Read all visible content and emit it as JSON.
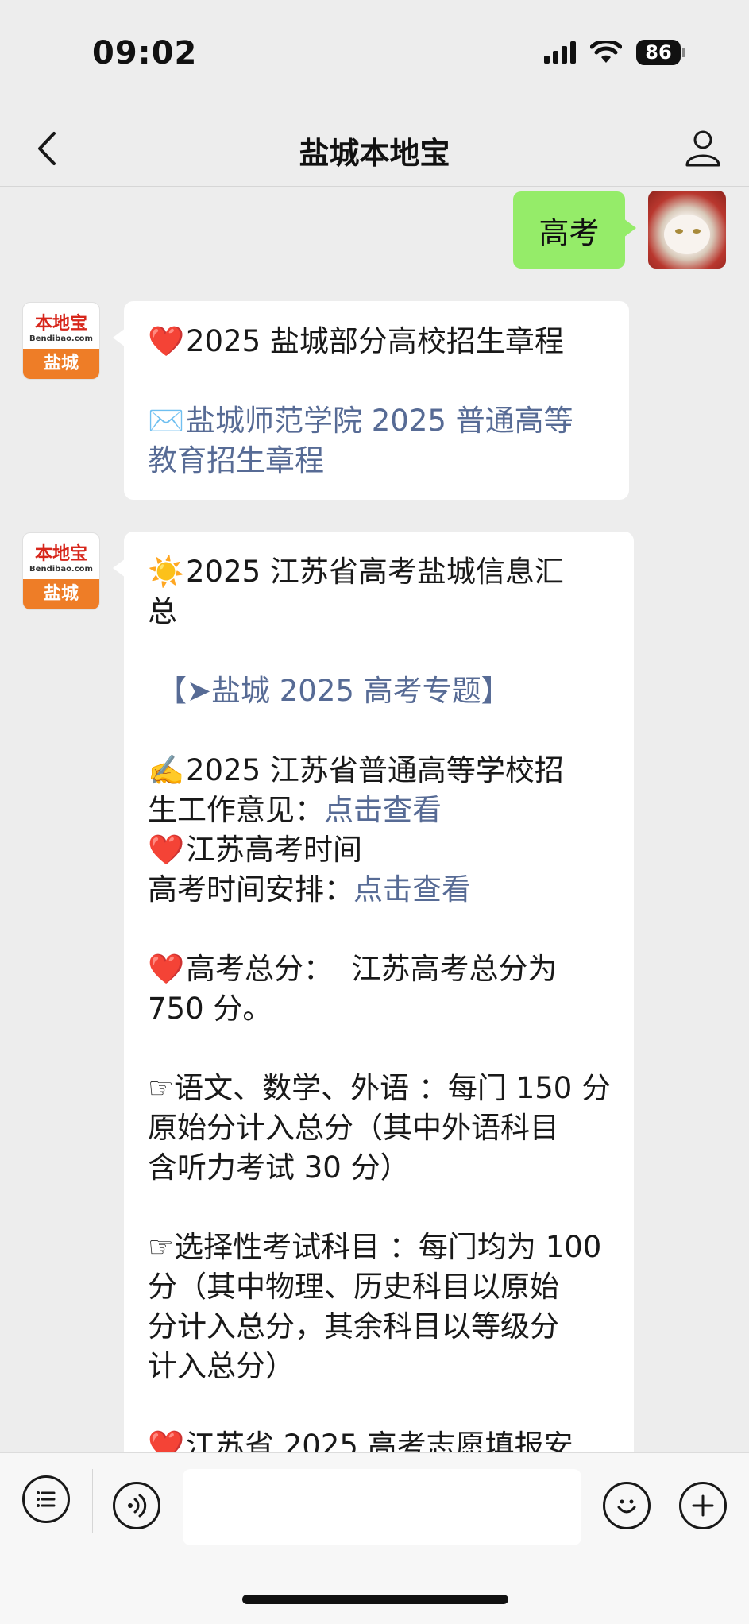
{
  "status_bar": {
    "time": "09:02",
    "battery": "86"
  },
  "nav": {
    "title": "盐城本地宝"
  },
  "user_message": {
    "text": "高考"
  },
  "bot": {
    "avatar_brand": "本地宝",
    "avatar_domain": "Bendibao.com",
    "avatar_city": "盐城"
  },
  "message1": {
    "line1_emoji": "❤️",
    "line1": "2025 盐城部分高校招生章程",
    "link_emoji": "✉️",
    "link_text_line1": "盐城师范学院 2025 普通高等",
    "link_text_line2": "教育招生章程"
  },
  "message2": {
    "title_emoji": "☀️",
    "title_line1": "2025 江苏省高考盐城信息汇",
    "title_line2": "总",
    "topic_link": "【➤盐城 2025 高考专题】",
    "item1_emoji": "✍️",
    "item1_line1": "2025 江苏省普通高等学校招",
    "item1_line2_prefix": "生工作意见：",
    "item1_link": "点击查看",
    "item2_emoji": "❤️",
    "item2_title": "江苏高考时间",
    "item2_prefix": "高考时间安排：",
    "item2_link": "点击查看",
    "item3_emoji": "❤️",
    "item3_line1": "高考总分：  江苏高考总分为",
    "item3_line2": "750 分。",
    "item4_emoji": "☞",
    "item4_line1": "语文、数学、外语 ：每门 150 分",
    "item4_line2": "原始分计入总分（其中外语科目",
    "item4_line3": "含听力考试 30 分）",
    "item5_emoji": "☞",
    "item5_line1": "选择性考试科目 ：每门均为 100",
    "item5_line2": "分（其中物理、历史科目以原始",
    "item5_line3": "分计入总分，其余科目以等级分",
    "item5_line4": "计入总分）",
    "item6_emoji": "❤️",
    "item6_line1": "江苏省 2025 高考志愿填报安"
  }
}
